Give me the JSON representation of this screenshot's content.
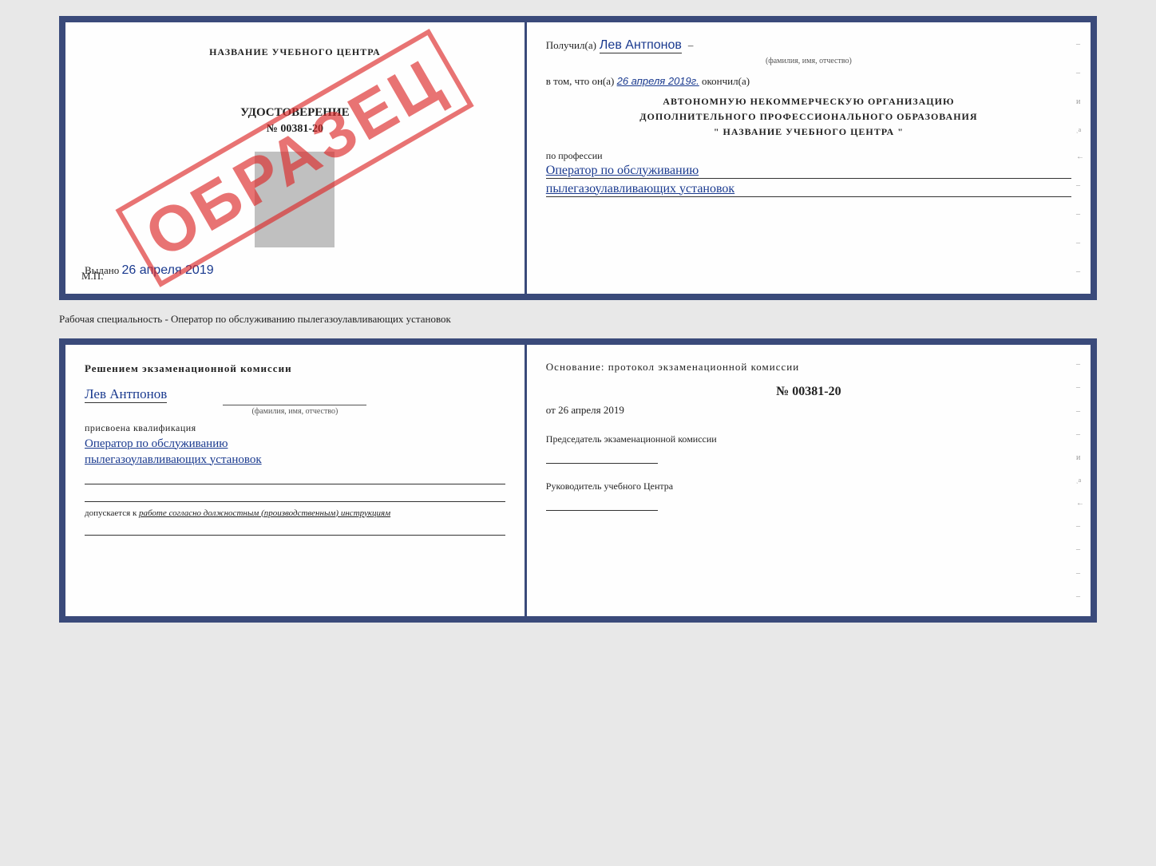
{
  "top_left": {
    "school_name": "НАЗВАНИЕ УЧЕБНОГО ЦЕНТРА",
    "cert_title": "УДОСТОВЕРЕНИЕ",
    "cert_number": "№ 00381-20",
    "issued_label": "Выдано",
    "issued_date": "26 апреля 2019",
    "mp_label": "М.П.",
    "sample_text": "ОБРАЗЕЦ"
  },
  "top_right": {
    "received_label": "Получил(а)",
    "recipient_name": "Лев Антпонов",
    "fio_sublabel": "(фамилия, имя, отчество)",
    "completed_prefix": "в том, что он(а)",
    "completed_date": "26 апреля 2019г.",
    "completed_suffix": "окончил(а)",
    "org_line1": "АВТОНОМНУЮ НЕКОММЕРЧЕСКУЮ ОРГАНИЗАЦИЮ",
    "org_line2": "ДОПОЛНИТЕЛЬНОГО ПРОФЕССИОНАЛЬНОГО ОБРАЗОВАНИЯ",
    "org_line3": "\"   НАЗВАНИЕ УЧЕБНОГО ЦЕНТРА   \"",
    "profession_label": "по профессии",
    "profession_line1": "Оператор по обслуживанию",
    "profession_line2": "пылегазоулавливающих установок",
    "side_dashes": [
      "–",
      "–",
      "и",
      "ͺа",
      "←",
      "–",
      "–",
      "–",
      "–"
    ]
  },
  "separator": {
    "text": "Рабочая специальность - Оператор по обслуживанию пылегазоулавливающих установок"
  },
  "bottom_left": {
    "decision_text": "Решением экзаменационной комиссии",
    "person_name": "Лев Антпонов",
    "fio_sublabel": "(фамилия, имя, отчество)",
    "assigned_text": "присвоена квалификация",
    "qual_line1": "Оператор по обслуживанию",
    "qual_line2": "пылегазоулавливающих установок",
    "admitted_prefix": "допускается к",
    "admitted_text": "работе согласно должностным (производственным) инструкциям"
  },
  "bottom_right": {
    "basis_text": "Основание: протокол экзаменационной комиссии",
    "protocol_number": "№  00381-20",
    "date_prefix": "от",
    "protocol_date": "26 апреля 2019",
    "chairman_label": "Председатель экзаменационной комиссии",
    "director_label": "Руководитель учебного Центра",
    "side_dashes": [
      "–",
      "–",
      "–",
      "–",
      "и",
      "ͺа",
      "←",
      "–",
      "–",
      "–",
      "–"
    ]
  }
}
